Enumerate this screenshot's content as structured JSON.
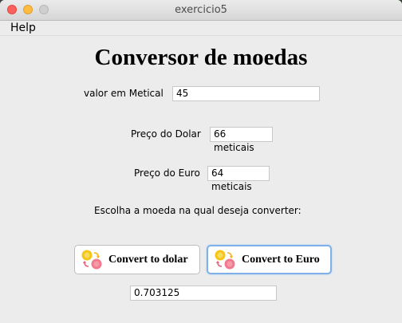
{
  "window": {
    "title": "exercicio5"
  },
  "menu": {
    "help": "Help"
  },
  "app": {
    "heading": "Conversor de moedas",
    "metical_label": "valor em Metical",
    "metical_value": "45",
    "dolar_label": "Preço do Dolar",
    "dolar_value": "66 meticais",
    "euro_label": "Preço do Euro",
    "euro_value": "64 meticais",
    "prompt": "Escolha a moeda na qual deseja converter:",
    "convert_dolar_label": "Convert to dolar",
    "convert_euro_label": "Convert to Euro",
    "result_value": "0.703125"
  },
  "icons": {
    "traffic_lights": [
      "close-icon",
      "minimize-icon",
      "maximize-icon"
    ],
    "button_icon": "currency-exchange-icon"
  },
  "colors": {
    "focus_border": "#7fb0ea",
    "coin_gold": "#f5c518",
    "coin_pink": "#f27a8f"
  }
}
